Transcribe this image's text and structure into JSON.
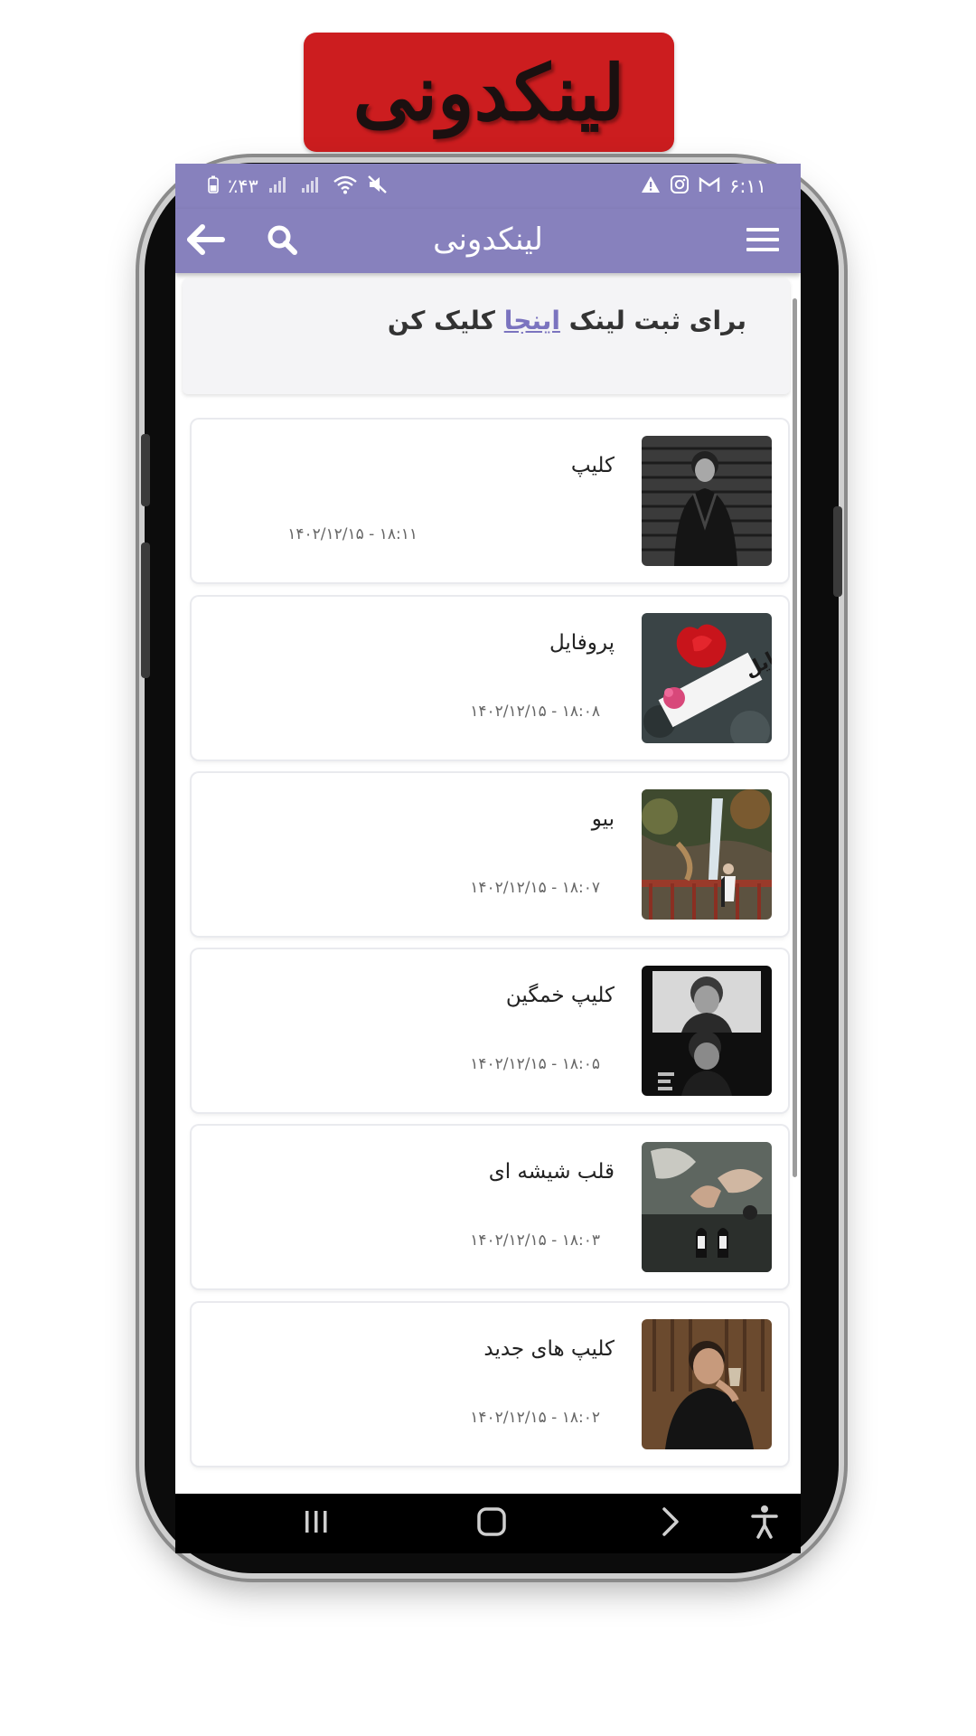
{
  "banner": {
    "title": "لینکدونی"
  },
  "status_bar": {
    "time": "۶:۱۱",
    "battery": "٪۴۳"
  },
  "app_bar": {
    "title": "لینکدونی"
  },
  "notice": {
    "before": "برای ثبت لینک ",
    "link": "اینجا",
    "after": " کلیک کن"
  },
  "posts": [
    {
      "title": "کلیپ",
      "date": "۱۸:۱۱ - ۱۴۰۲/۱۲/۱۵"
    },
    {
      "title": "پروفایل",
      "date": "۱۸:۰۸ - ۱۴۰۲/۱۲/۱۵",
      "thumb_text": "پروفایل"
    },
    {
      "title": "بیو",
      "date": "۱۸:۰۷ - ۱۴۰۲/۱۲/۱۵"
    },
    {
      "title": "کلیپ خمگین",
      "date": "۱۸:۰۵ - ۱۴۰۲/۱۲/۱۵"
    },
    {
      "title": "قلب شیشه ای",
      "date": "۱۸:۰۳ - ۱۴۰۲/۱۲/۱۵"
    },
    {
      "title": "کلیپ های جدید",
      "date": "۱۸:۰۲ - ۱۴۰۲/۱۲/۱۵"
    }
  ],
  "colors": {
    "accent": "#8781bd",
    "banner": "#cc1d1f",
    "link": "#7b74bf"
  },
  "icons": {
    "menu": "hamburger-menu-icon",
    "search": "search-icon",
    "back": "arrow-back-icon",
    "nav_recents": "recents-icon",
    "nav_home": "home-icon",
    "nav_back": "chevron-back-icon",
    "accessibility": "accessibility-icon"
  }
}
